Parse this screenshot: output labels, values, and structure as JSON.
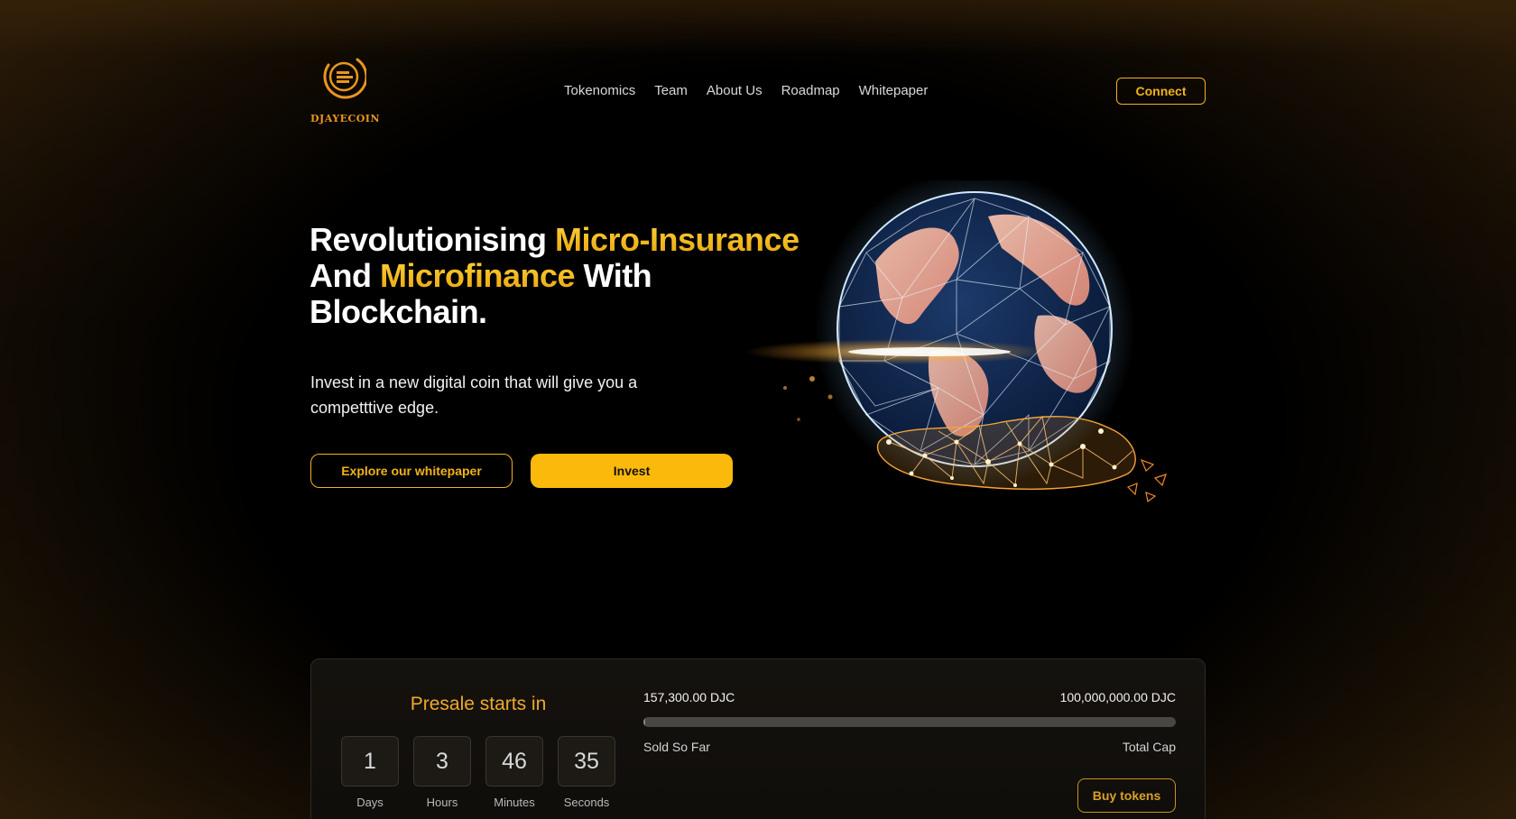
{
  "brand": {
    "name": "DJAYECOIN",
    "logo_icon": "coin-ring-icon",
    "color": "#e8961f"
  },
  "nav": {
    "items": [
      "Tokenomics",
      "Team",
      "About Us",
      "Roadmap",
      "Whitepaper"
    ]
  },
  "header": {
    "connect_label": "Connect"
  },
  "hero": {
    "title_part1": "Revolutionising ",
    "title_accent1": "Micro-Insurance",
    "title_part2": "And ",
    "title_accent2": "Microfinance",
    "title_part3": " With",
    "title_part4": "Blockchain.",
    "subtitle": "Invest in a new digital coin that will give you a competttive edge.",
    "whitepaper_button": "Explore our whitepaper",
    "invest_button": "Invest",
    "illustration": "globe-in-hand-icon"
  },
  "presale": {
    "title": "Presale starts in",
    "countdown": [
      {
        "value": "1",
        "label": "Days"
      },
      {
        "value": "3",
        "label": "Hours"
      },
      {
        "value": "46",
        "label": "Minutes"
      },
      {
        "value": "35",
        "label": "Seconds"
      }
    ],
    "sold_amount": "157,300.00 DJC",
    "total_amount": "100,000,000.00 DJC",
    "sold_label": "Sold So Far",
    "total_label": "Total Cap",
    "progress_fraction": 0.001573,
    "buy_button": "Buy tokens"
  },
  "colors": {
    "accent": "#fbb90c",
    "accent_text": "#f2b31a",
    "background": "#000000"
  }
}
